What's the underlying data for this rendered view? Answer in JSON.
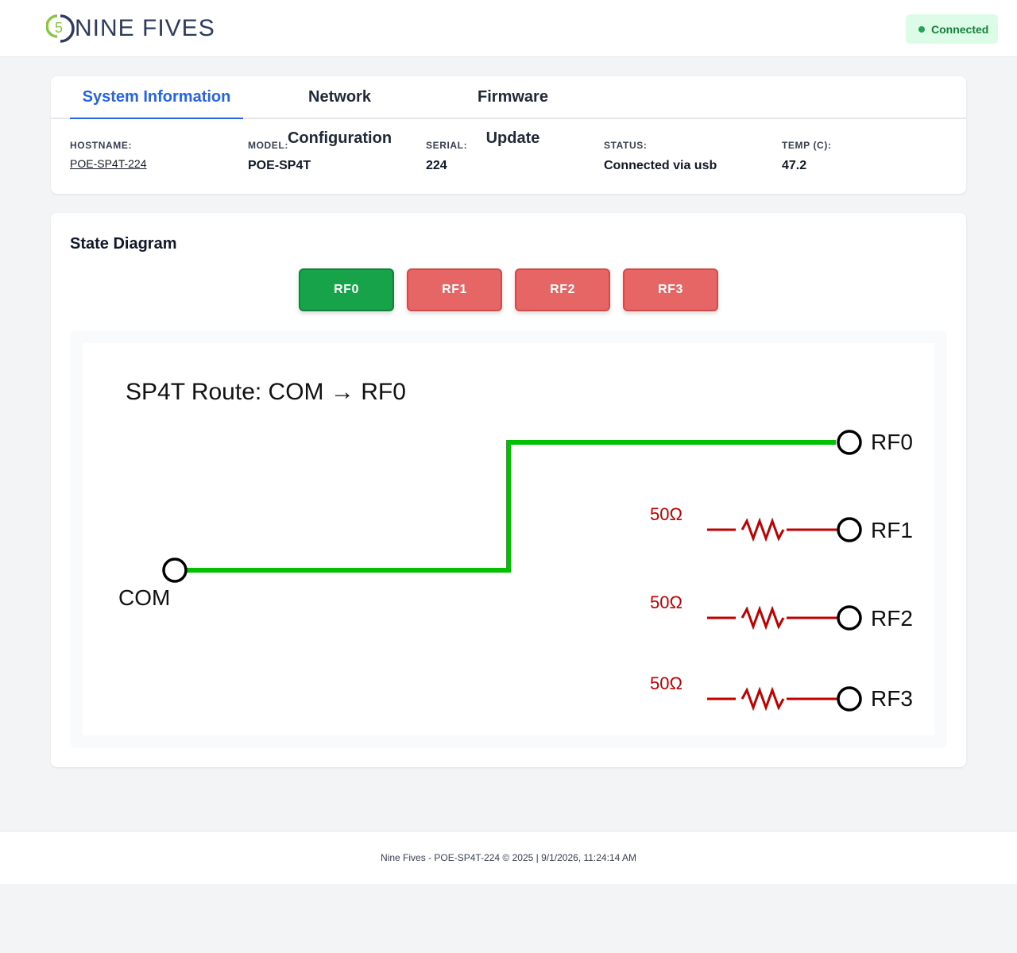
{
  "brand": {
    "name": "NINE FIVES",
    "mark_digit": "5"
  },
  "connection": {
    "label": "Connected",
    "color": "#22a35a"
  },
  "tabs": [
    {
      "label": "System Information",
      "active": true
    },
    {
      "label": "Network Configuration",
      "active": false
    },
    {
      "label": "Firmware Update",
      "active": false
    }
  ],
  "info": {
    "hostname": {
      "label": "HOSTNAME:",
      "value": "POE-SP4T-224"
    },
    "model": {
      "label": "MODEL:",
      "value": "POE-SP4T"
    },
    "serial": {
      "label": "SERIAL:",
      "value": "224"
    },
    "status": {
      "label": "STATUS:",
      "value": "Connected via usb"
    },
    "temp": {
      "label": "TEMP (C):",
      "value": "47.2"
    }
  },
  "state": {
    "title": "State Diagram",
    "buttons": [
      {
        "label": "RF0",
        "active": true
      },
      {
        "label": "RF1",
        "active": false
      },
      {
        "label": "RF2",
        "active": false
      },
      {
        "label": "RF3",
        "active": false
      }
    ],
    "diagram": {
      "route_title": "SP4T Route: COM → RF0",
      "common_label": "COM",
      "ports": [
        {
          "label": "RF0",
          "connected": true
        },
        {
          "label": "RF1",
          "connected": false,
          "termination": "50Ω"
        },
        {
          "label": "RF2",
          "connected": false,
          "termination": "50Ω"
        },
        {
          "label": "RF3",
          "connected": false,
          "termination": "50Ω"
        }
      ],
      "colors": {
        "active_path": "#00c000",
        "termination": "#c00000",
        "node": "#000000"
      }
    }
  },
  "footer": {
    "text": "Nine Fives - POE-SP4T-224 © 2025 | 9/1/2026, 11:24:14 AM"
  },
  "colors": {
    "accent": "#2563eb",
    "active_button": "#16a34a",
    "inactive_button": "#e66565",
    "connected_badge_bg": "#dcfce7"
  }
}
